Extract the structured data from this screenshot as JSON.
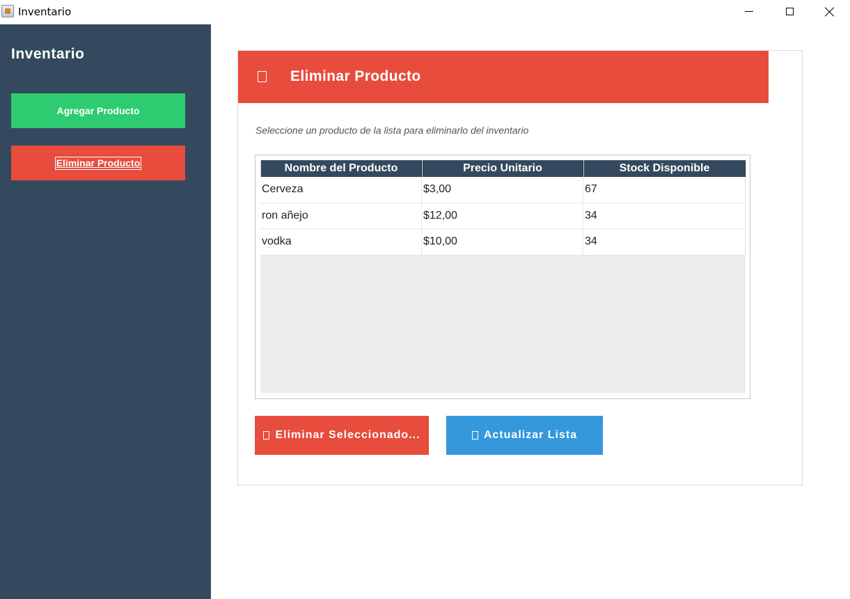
{
  "window": {
    "title": "Inventario",
    "icons": {
      "app": "java-app-icon",
      "minimize": "minimize-icon",
      "maximize": "maximize-icon",
      "close": "close-icon"
    }
  },
  "sidebar": {
    "title": "Inventario",
    "items": [
      {
        "label": "Agregar Producto",
        "color": "#2ecc71"
      },
      {
        "label": "Eliminar Producto",
        "color": "#e74c3c"
      }
    ],
    "background": "#34495e"
  },
  "main": {
    "header": {
      "title": "Eliminar Producto",
      "icon": "trash-icon",
      "color": "#e74c3c"
    },
    "instruction": "Seleccione un producto de la lista para eliminarlo del inventario",
    "table": {
      "columns": [
        "Nombre del Producto",
        "Precio Unitario",
        "Stock Disponible"
      ],
      "rows": [
        [
          "Cerveza",
          "$3,00",
          "67"
        ],
        [
          "ron añejo",
          "$12,00",
          "34"
        ],
        [
          "vodka",
          "$10,00",
          "34"
        ]
      ]
    },
    "buttons": {
      "delete_label": "Eliminar Seleccionado...",
      "refresh_label": "Actualizar Lista",
      "delete_color": "#e74c3c",
      "refresh_color": "#3498db"
    }
  }
}
